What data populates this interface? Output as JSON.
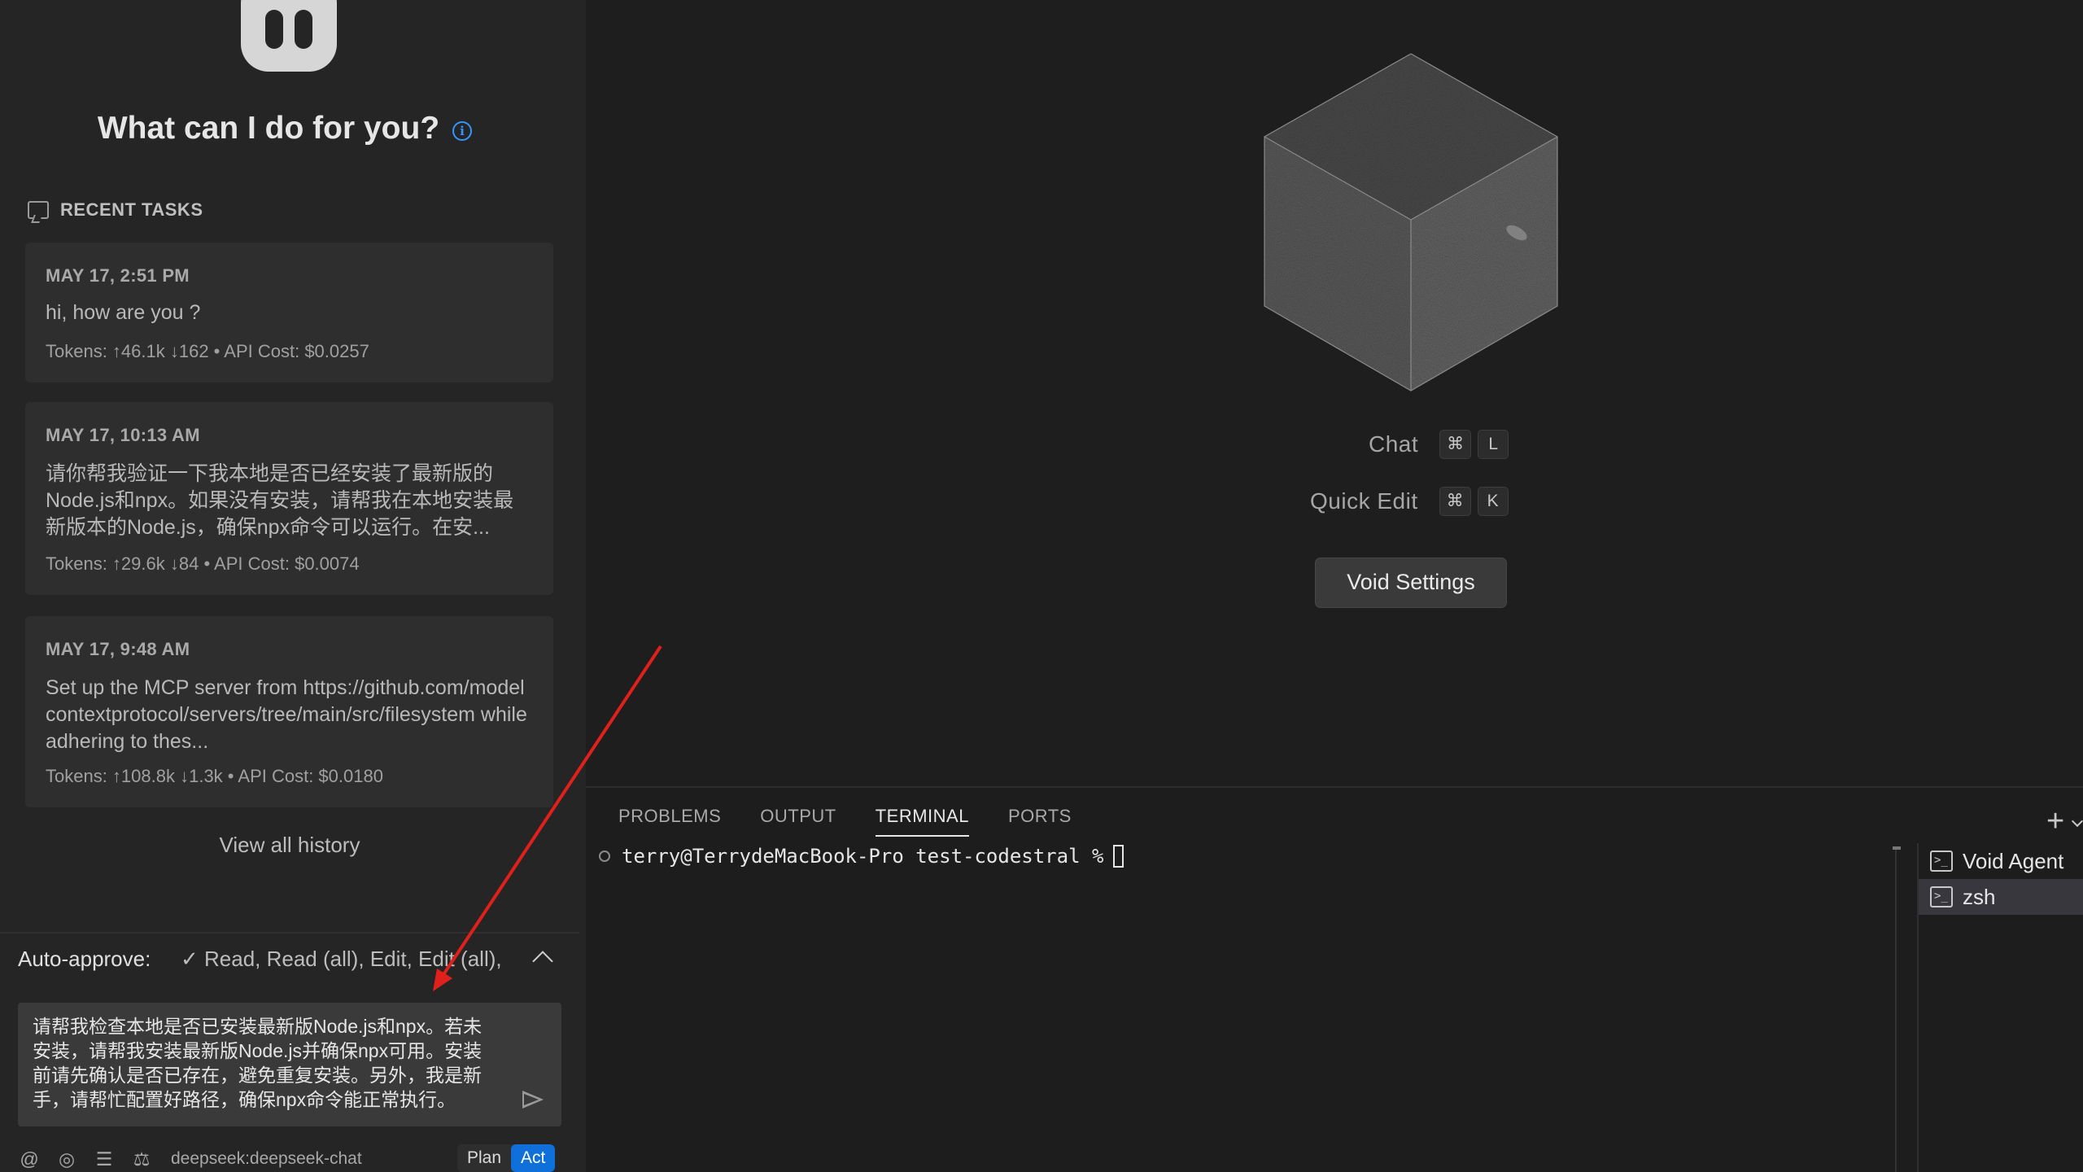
{
  "sidebar": {
    "welcome": "What can I do for you?",
    "recent_heading": "RECENT TASKS",
    "tasks": [
      {
        "date": "MAY 17, 2:51 PM",
        "text": "hi, how are you ?",
        "meta": "Tokens: ↑46.1k ↓162 • API Cost: $0.0257"
      },
      {
        "date": "MAY 17, 10:13 AM",
        "text": "请你帮我验证一下我本地是否已经安装了最新版的Node.js和npx。如果没有安装，请帮我在本地安装最新版本的Node.js，确保npx命令可以运行。在安...",
        "meta": "Tokens: ↑29.6k ↓84 • API Cost: $0.0074"
      },
      {
        "date": "MAY 17, 9:48 AM",
        "text": "Set up the MCP server from https://github.com/modelcontextprotocol/servers/tree/main/src/filesystem while adhering to thes...",
        "meta": "Tokens: ↑108.8k ↓1.3k • API Cost: $0.0180"
      }
    ],
    "view_history": "View all history",
    "auto_approve_label": "Auto-approve:",
    "auto_approve_values": "✓ Read, Read (all), Edit, Edit (all),",
    "chat_input_value": "请帮我检查本地是否已安装最新版Node.js和npx。若未安装，请帮我安装最新版Node.js并确保npx可用。安装前请先确认是否已存在，避免重复安装。另外，我是新手，请帮忙配置好路径，确保npx命令能正常执行。",
    "bottom_icons": [
      "at-icon",
      "camera-icon",
      "server-icon",
      "balance-icon"
    ],
    "bottom_glyphs": {
      "at": "@",
      "camera": "◎",
      "server": "☰",
      "balance": "⚖"
    },
    "model_name": "deepseek:deepseek-chat",
    "mode_plan": "Plan",
    "mode_act": "Act"
  },
  "editor": {
    "shortcuts": [
      {
        "label": "Chat",
        "keys": [
          "⌘",
          "L"
        ]
      },
      {
        "label": "Quick Edit",
        "keys": [
          "⌘",
          "K"
        ]
      }
    ],
    "settings_button": "Void Settings"
  },
  "panel": {
    "tabs": [
      "PROBLEMS",
      "OUTPUT",
      "TERMINAL",
      "PORTS"
    ],
    "active_tab": "TERMINAL",
    "add_glyph": "+",
    "terminal_prompt": "terry@TerrydeMacBook-Pro test-codestral % ",
    "terminals": [
      {
        "name": "Void Agent",
        "selected": false
      },
      {
        "name": "zsh",
        "selected": true
      }
    ],
    "terminal_glyph": ">_"
  },
  "colors": {
    "accent": "#0e70d8",
    "info": "#3794ff",
    "annotation_arrow": "#e0201b"
  }
}
